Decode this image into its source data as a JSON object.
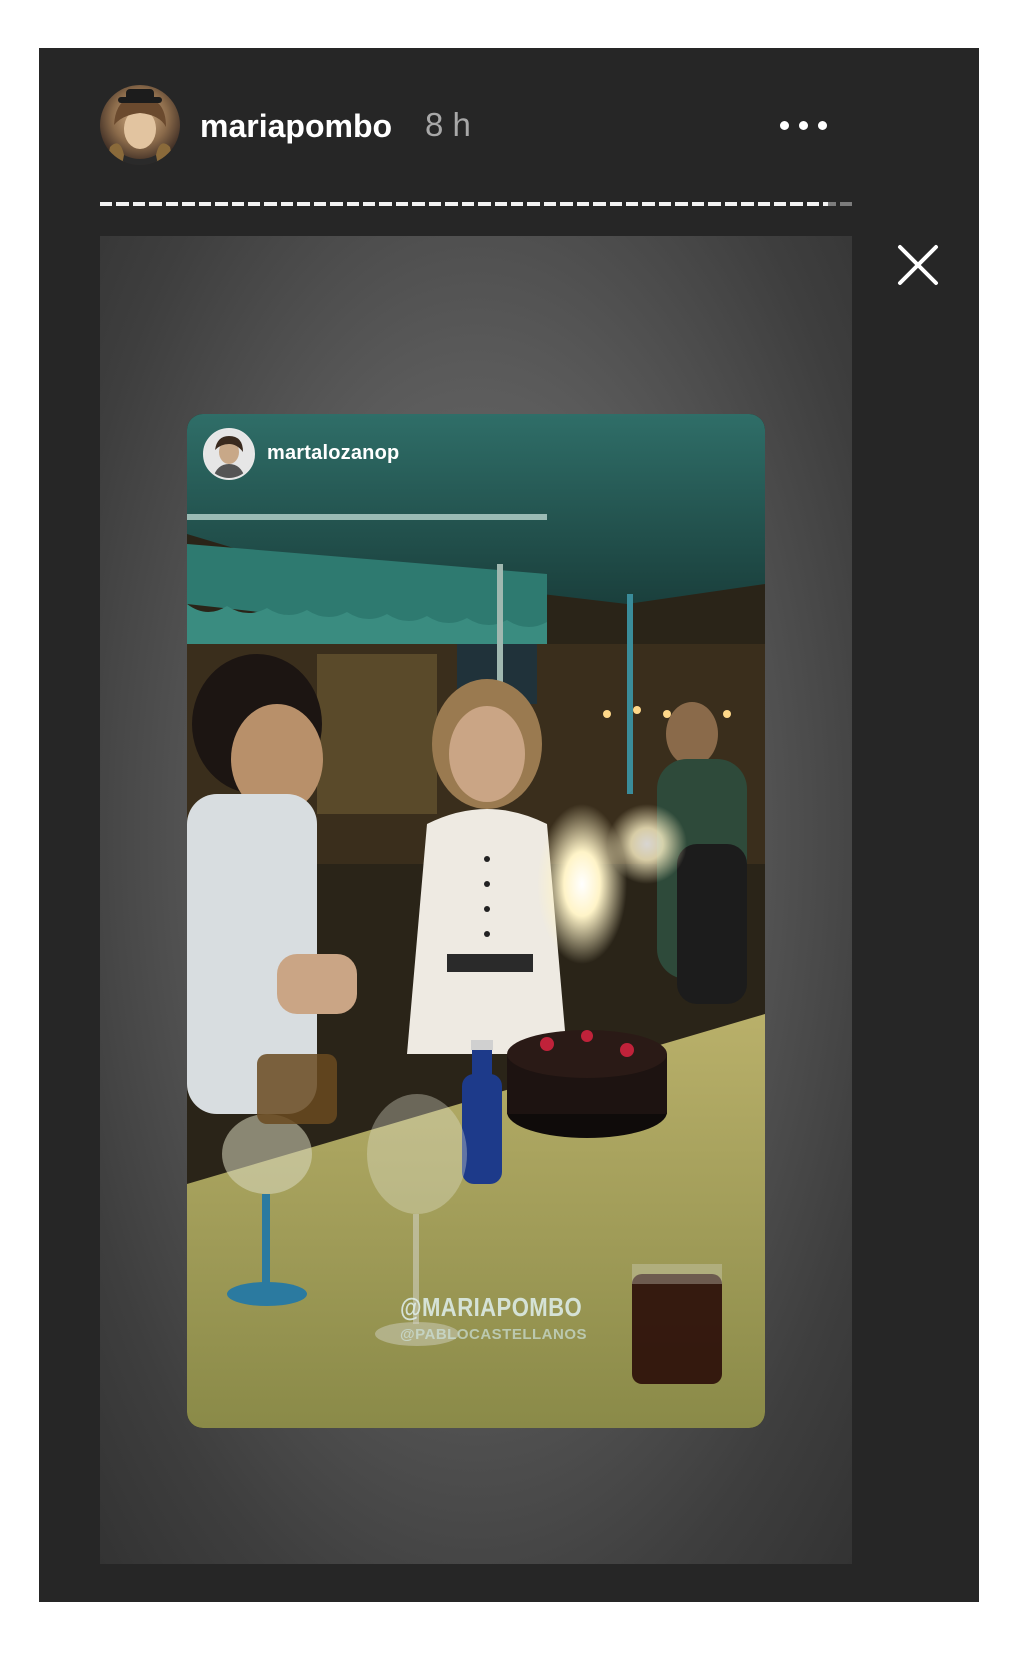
{
  "header": {
    "username": "mariapombo",
    "time_ago": "8 h"
  },
  "story": {
    "progress_segments": 46,
    "current_segment": 44,
    "reposted_from": "martalozanop",
    "mention_main": "@MARIAPOMBO",
    "mention_secondary": "@PABLOCASTELLANOS"
  },
  "icons": {
    "more": "more-options-icon",
    "close": "close-icon"
  },
  "colors": {
    "viewer_bg": "#262626",
    "progress_filled": "#f2f2f2",
    "progress_empty": "#7c7c7c",
    "time_text": "#a8a8a8"
  }
}
